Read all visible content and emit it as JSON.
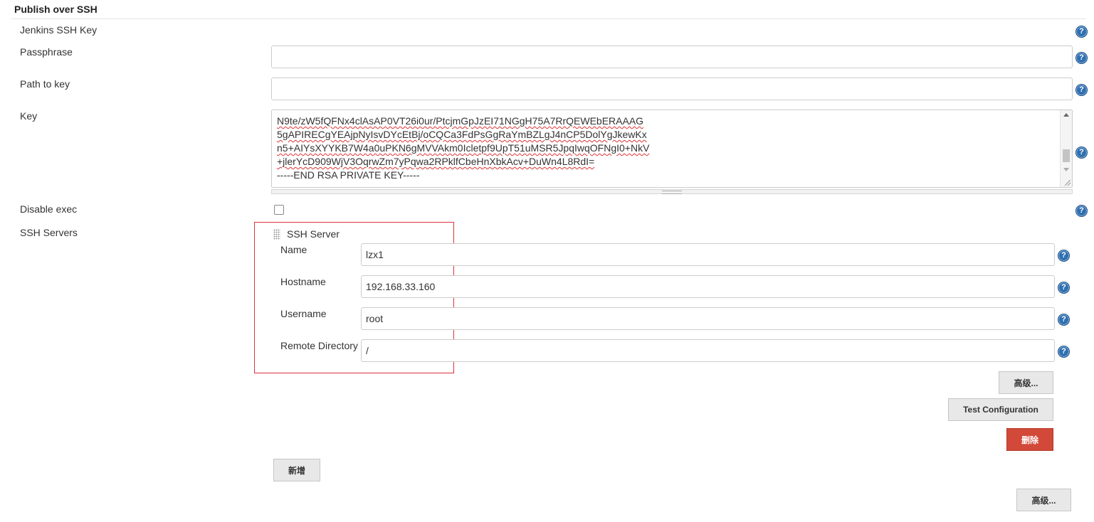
{
  "section": {
    "title": "Publish over SSH"
  },
  "fields": {
    "jenkins_ssh_key": {
      "label": "Jenkins SSH Key"
    },
    "passphrase": {
      "label": "Passphrase",
      "value": ""
    },
    "path_to_key": {
      "label": "Path to key",
      "value": ""
    },
    "key": {
      "label": "Key",
      "lines": [
        "N9te/zW5fQFNx4clAsAP0VT26i0ur/PtcjmGpJzEI71NGgH75A7RrQEWEbERAAAG",
        "5gAPIRECgYEAjpNyIsvDYcEtBj/oCQCa3FdPsGgRaYmBZLgJ4nCP5DolYgJkewKx",
        "n5+AIYsXYYKB7W4a0uPKN6gMVVAkm0Icletpf9UpT51uMSR5JpqIwqOFNgI0+NkV",
        "+jlerYcD909WjV3OqrwZm7yPqwa2RPklfCbeHnXbkAcv+DuWn4L8RdI=",
        "-----END RSA PRIVATE KEY-----"
      ]
    },
    "disable_exec": {
      "label": "Disable exec",
      "checked": false
    },
    "ssh_servers": {
      "label": "SSH Servers"
    }
  },
  "ssh_server": {
    "header": "SSH Server",
    "name": {
      "label": "Name",
      "value": "lzx1"
    },
    "hostname": {
      "label": "Hostname",
      "value": "192.168.33.160"
    },
    "username": {
      "label": "Username",
      "value": "root"
    },
    "remote_directory": {
      "label": "Remote Directory",
      "value": "/"
    }
  },
  "buttons": {
    "server_advanced": "高级...",
    "test_configuration": "Test Configuration",
    "delete": "删除",
    "add": "新增",
    "advanced": "高级..."
  },
  "help_glyph": "?",
  "colors": {
    "help_icon": "#2f6fb0",
    "delete_button": "#d24939",
    "highlight_frame": "#d9333f"
  }
}
